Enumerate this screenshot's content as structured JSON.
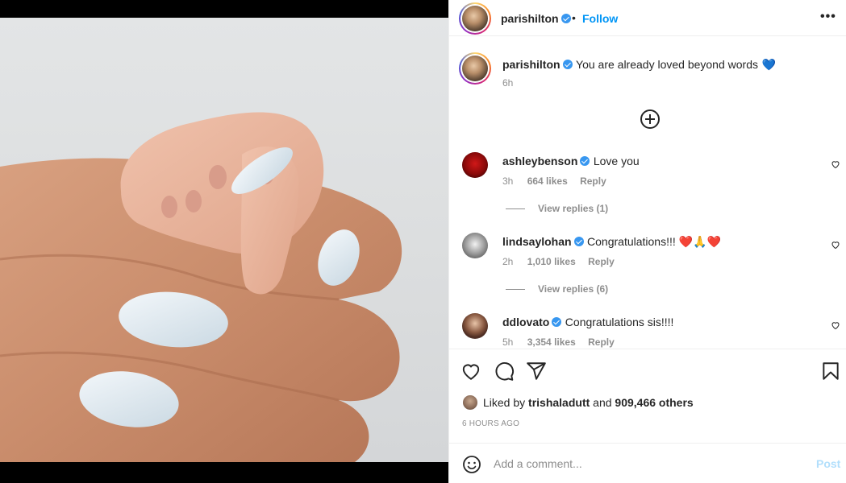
{
  "post": {
    "author": "parishilton",
    "follow_label": "Follow",
    "separator": "•",
    "more_label": "•••",
    "caption": "You are already loved beyond words",
    "caption_emoji": "💙",
    "caption_time": "6h"
  },
  "comments": [
    {
      "user": "ashleybenson",
      "text": "Love you",
      "time": "3h",
      "likes": "664 likes",
      "reply": "Reply",
      "view_replies": "View replies (1)"
    },
    {
      "user": "lindsaylohan",
      "text": "Congratulations!!! ❤️🙏❤️",
      "time": "2h",
      "likes": "1,010 likes",
      "reply": "Reply",
      "view_replies": "View replies (6)"
    },
    {
      "user": "ddlovato",
      "text": "Congratulations sis!!!!",
      "time": "5h",
      "likes": "3,354 likes",
      "reply": "Reply"
    }
  ],
  "likes": {
    "prefix": "Liked by",
    "user": "trishaladutt",
    "and": "and",
    "others": "909,466 others"
  },
  "timestamp": "6 HOURS AGO",
  "composer": {
    "placeholder": "Add a comment...",
    "post_label": "Post"
  },
  "icons": {
    "like": "heart-icon",
    "comment": "comment-icon",
    "share": "share-icon",
    "save": "bookmark-icon",
    "emoji": "emoji-icon",
    "add": "plus-circle-icon"
  },
  "colors": {
    "link": "#0095f6",
    "verified": "#3897f0",
    "muted": "#8e8e8e",
    "post_disabled": "#b2dffc"
  }
}
